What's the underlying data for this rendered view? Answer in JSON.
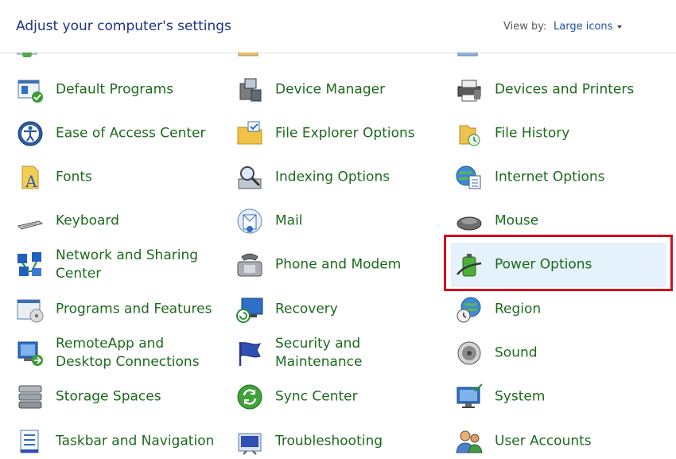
{
  "header": {
    "title": "Adjust your computer's settings",
    "view_by_label": "View by:",
    "view_by_value": "Large icons"
  },
  "items": [
    {
      "label": "Default Programs",
      "icon": "default-programs-icon"
    },
    {
      "label": "Device Manager",
      "icon": "device-manager-icon"
    },
    {
      "label": "Devices and Printers",
      "icon": "devices-printers-icon"
    },
    {
      "label": "Ease of Access Center",
      "icon": "ease-of-access-icon"
    },
    {
      "label": "File Explorer Options",
      "icon": "file-explorer-options-icon"
    },
    {
      "label": "File History",
      "icon": "file-history-icon"
    },
    {
      "label": "Fonts",
      "icon": "fonts-icon"
    },
    {
      "label": "Indexing Options",
      "icon": "indexing-options-icon"
    },
    {
      "label": "Internet Options",
      "icon": "internet-options-icon"
    },
    {
      "label": "Keyboard",
      "icon": "keyboard-icon"
    },
    {
      "label": "Mail",
      "icon": "mail-icon"
    },
    {
      "label": "Mouse",
      "icon": "mouse-icon"
    },
    {
      "label": "Network and Sharing Center",
      "icon": "network-sharing-icon"
    },
    {
      "label": "Phone and Modem",
      "icon": "phone-modem-icon"
    },
    {
      "label": "Power Options",
      "icon": "power-options-icon"
    },
    {
      "label": "Programs and Features",
      "icon": "programs-features-icon"
    },
    {
      "label": "Recovery",
      "icon": "recovery-icon"
    },
    {
      "label": "Region",
      "icon": "region-icon"
    },
    {
      "label": "RemoteApp and Desktop Connections",
      "icon": "remoteapp-icon"
    },
    {
      "label": "Security and Maintenance",
      "icon": "security-maintenance-icon"
    },
    {
      "label": "Sound",
      "icon": "sound-icon"
    },
    {
      "label": "Storage Spaces",
      "icon": "storage-spaces-icon"
    },
    {
      "label": "Sync Center",
      "icon": "sync-center-icon"
    },
    {
      "label": "System",
      "icon": "system-icon"
    },
    {
      "label": "Taskbar and Navigation",
      "icon": "taskbar-navigation-icon"
    },
    {
      "label": "Troubleshooting",
      "icon": "troubleshooting-icon"
    },
    {
      "label": "User Accounts",
      "icon": "user-accounts-icon"
    }
  ]
}
